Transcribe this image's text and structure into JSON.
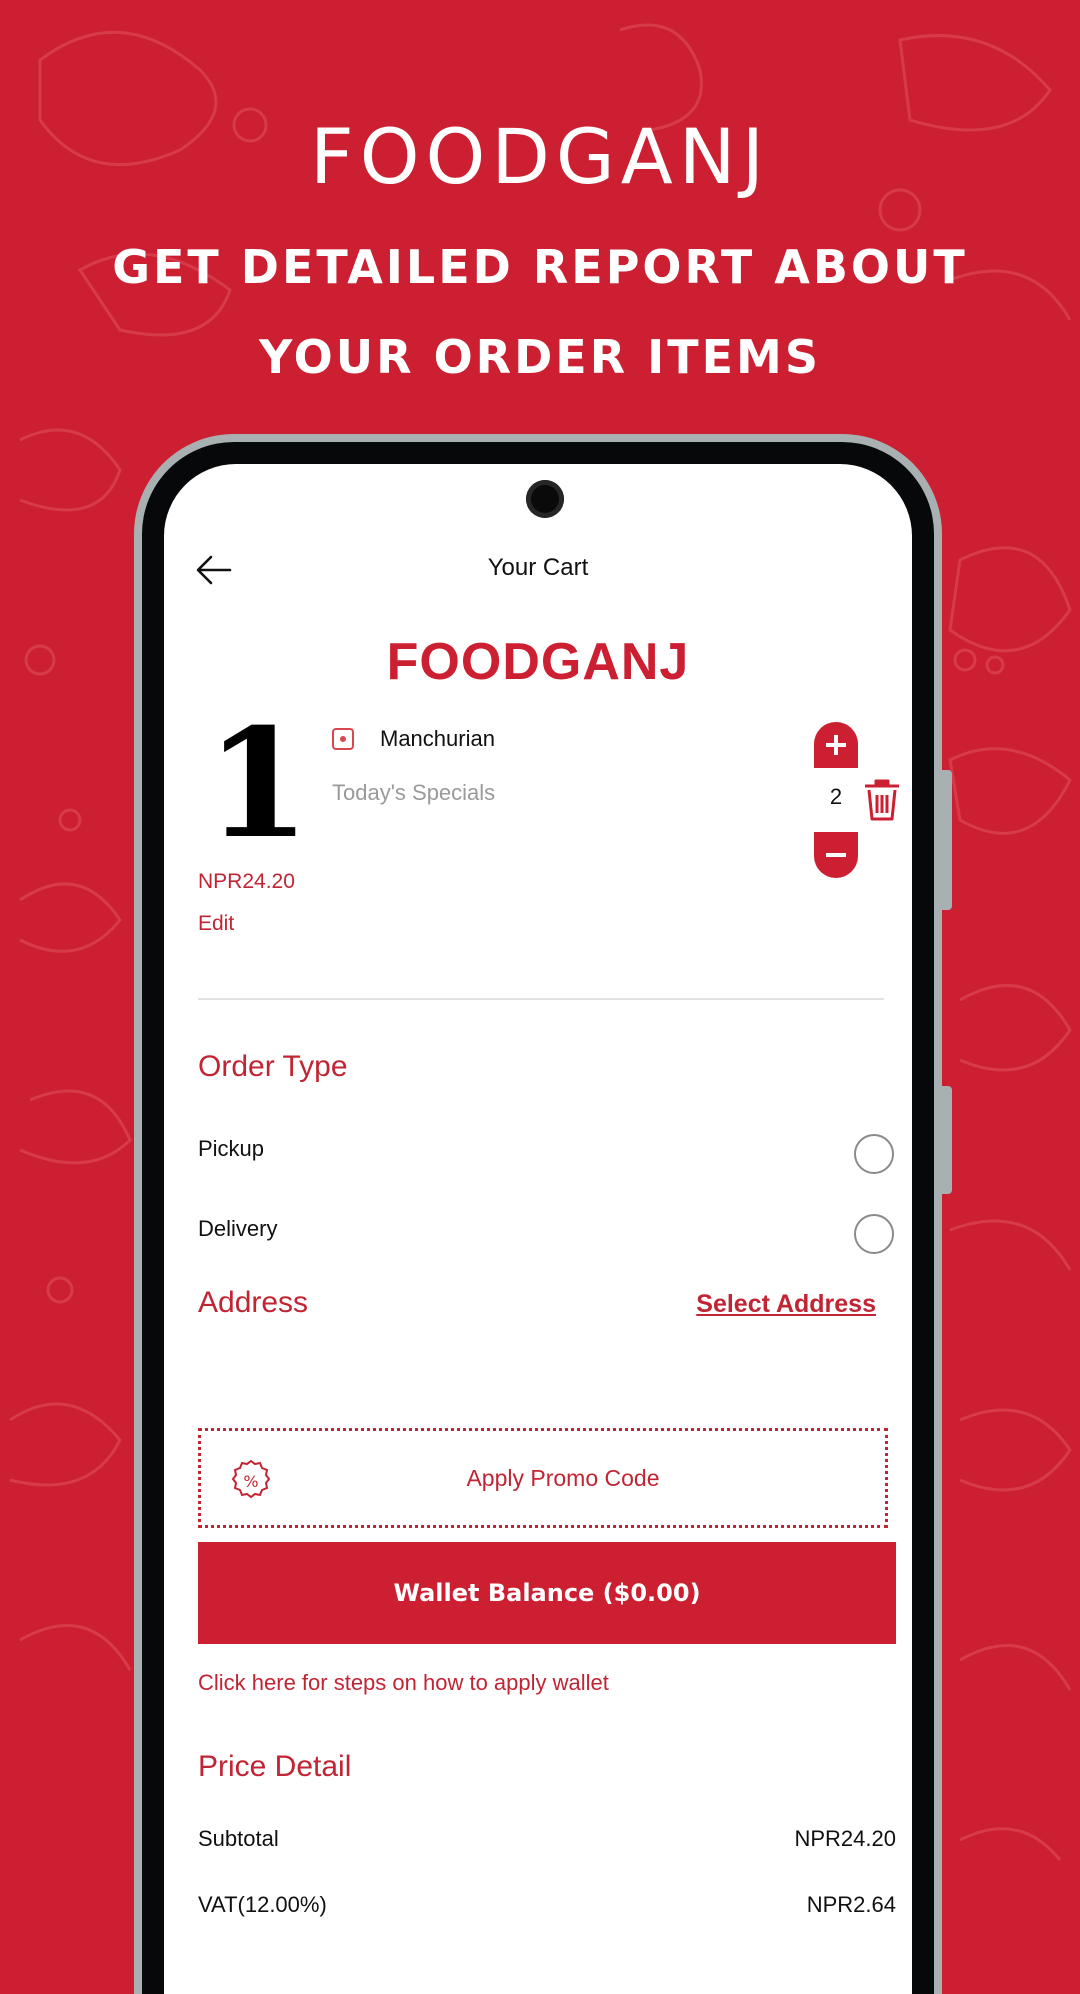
{
  "promo": {
    "brand": "FOODGANJ",
    "tagline_line1": "GET DETAILED REPORT ABOUT",
    "tagline_line2": "YOUR ORDER ITEMS"
  },
  "colors": {
    "brand_red": "#cc1f31",
    "text_red": "#c12534",
    "frame_gray": "#a9b0b2"
  },
  "topbar": {
    "back_icon": "arrow-left-icon",
    "title": "Your Cart"
  },
  "store": {
    "name": "FOODGANJ"
  },
  "cart_items": [
    {
      "thumbnail_text": "1",
      "diet_icon": "veg-indicator-icon",
      "name": "Manchurian",
      "category": "Today's Specials",
      "price": "NPR24.20",
      "edit_label": "Edit",
      "quantity": "2",
      "increment_label": "+",
      "decrement_label": "−",
      "delete_icon": "trash-icon"
    }
  ],
  "order_type": {
    "title": "Order Type",
    "options": [
      {
        "label": "Pickup",
        "selected": false
      },
      {
        "label": "Delivery",
        "selected": false
      }
    ]
  },
  "address": {
    "title": "Address",
    "select_label": "Select Address"
  },
  "promo_code": {
    "icon": "percent-badge-icon",
    "label": "Apply Promo Code"
  },
  "wallet": {
    "button_label": "Wallet Balance ($0.00)",
    "help_link": "Click here for steps on how to apply wallet"
  },
  "price_detail": {
    "title": "Price Detail",
    "rows": [
      {
        "label": "Subtotal",
        "value": "NPR24.20"
      },
      {
        "label": "VAT(12.00%)",
        "value": "NPR2.64"
      }
    ]
  }
}
